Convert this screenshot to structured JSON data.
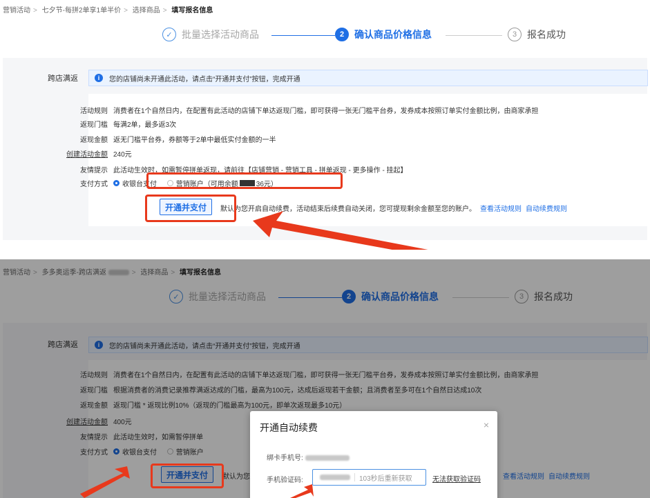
{
  "panel1": {
    "breadcrumb": [
      "营销活动",
      "七夕节-每拼2单享1单半价",
      "选择商品",
      "填写报名信息"
    ],
    "steps": [
      {
        "num": "✓",
        "label": "批量选择活动商品"
      },
      {
        "num": "2",
        "label": "确认商品价格信息"
      },
      {
        "num": "3",
        "label": "报名成功"
      }
    ],
    "section_label": "跨店满返",
    "notice": "您的店铺尚未开通此活动，请点击“开通并支付”按钮，完成开通",
    "rows": [
      {
        "k": "活动规则",
        "v": "消费者在1个自然日内，在配置有此活动的店铺下单达返现门槛，即可获得一张无门槛平台券，发券成本按照订单实付金额比例，由商家承担"
      },
      {
        "k": "返现门槛",
        "v": "每满2单，最多返3次"
      },
      {
        "k": "返现金额",
        "v": "返无门槛平台券，券额等于2单中最低实付金额的一半"
      },
      {
        "k": "创建活动金额",
        "v": "240元"
      },
      {
        "k": "友情提示",
        "v": "此活动生效时，如需暂停拼单返现，请前往【店铺营销 - 营销工具 - 拼单返现 - 更多操作 - 挂起】"
      }
    ],
    "pay_label": "支付方式",
    "pay_opt1": "收银台支付",
    "pay_opt2_prefix": "营销账户（可用余额",
    "pay_opt2_suffix": "36元）",
    "btn": "开通并支付",
    "tail_text_pre": "默认",
    "tail_text": "为您开启自动续费，活动结束后续费自动关闭，您可提现剩余金额至您的账户。",
    "link1": "查看活动规则",
    "link2": "自动续费规则"
  },
  "panel2": {
    "breadcrumb": [
      "营销活动",
      "多多奥运季-跨店满返",
      "选择商品",
      "填写报名信息"
    ],
    "steps": [
      {
        "num": "✓",
        "label": "批量选择活动商品"
      },
      {
        "num": "2",
        "label": "确认商品价格信息"
      },
      {
        "num": "3",
        "label": "报名成功"
      }
    ],
    "section_label": "跨店满返",
    "notice": "您的店铺尚未开通此活动，请点击“开通并支付”按钮，完成开通",
    "rows": [
      {
        "k": "活动规则",
        "v": "消费者在1个自然日内，在配置有此活动的店铺下单达返现门槛，即可获得一张无门槛平台券，发券成本按照订单实付金额比例，由商家承担"
      },
      {
        "k": "返现门槛",
        "v": "根据消费者的消费记录推荐满返达成的门槛，最高为100元，达成后返现若干金额；且消费者至多可在1个自然日达成10次"
      },
      {
        "k": "返现金额",
        "v": "返现门槛 * 返现比例10%（返现的门槛最高为100元，即单次返现最多10元）"
      },
      {
        "k": "创建活动金额",
        "v": "400元"
      },
      {
        "k": "友情提示",
        "v": "此活动生效时，如需暂停拼单"
      }
    ],
    "pay_label": "支付方式",
    "pay_opt1": "收银台支付",
    "pay_opt2": "营销账户",
    "btn": "开通并支付",
    "tail_text": "默认为您",
    "link1": "查看活动规则",
    "link2": "自动续费规则",
    "modal": {
      "title": "开通自动续费",
      "close": "×",
      "phone_label": "绑卡手机号:",
      "code_label": "手机验证码:",
      "countdown": "103秒后重新获取",
      "no_code": "无法获取验证码"
    }
  },
  "colors": {
    "accent": "#1f6fe5",
    "highlight": "#e8391c"
  }
}
